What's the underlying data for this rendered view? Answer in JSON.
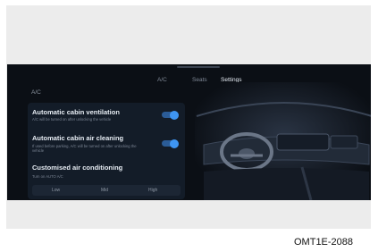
{
  "tabs": [
    {
      "label": "A/C",
      "active": false
    },
    {
      "label": "Seats",
      "active": false
    },
    {
      "label": "Settings",
      "active": true
    }
  ],
  "section_title": "A/C",
  "settings": [
    {
      "title": "Automatic cabin ventilation",
      "desc": "A/C will be turned on after unlocking the vehicle",
      "toggle_on": true
    },
    {
      "title": "Automatic cabin air cleaning",
      "desc": "If used before parking, A/C will be turned on after unlocking the vehicle",
      "toggle_on": true
    },
    {
      "title": "Customised air conditioning",
      "desc": "Turn on AUTO A/C"
    }
  ],
  "levels": [
    "Low",
    "Mid",
    "High"
  ],
  "caption": "OMT1E-2088",
  "colors": {
    "screen_bg": "#0b0f15",
    "panel_bg": "#131c28",
    "accent": "#3e95f2"
  }
}
